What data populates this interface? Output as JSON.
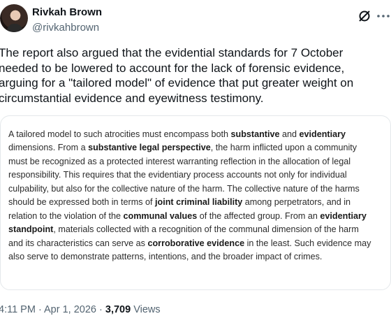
{
  "author": {
    "name": "Rivkah Brown",
    "handle": "@rivkahbrown"
  },
  "tweet": {
    "lines": [
      "The report also argued that the evidential standards for 7 October",
      "needed to be lowered to account for the lack of forensic evidence,",
      "arguing for a \"tailored model\" of evidence that put greater weight on",
      "circumstantial evidence and eyewitness testimony."
    ]
  },
  "image_text": {
    "l1a": "A tailored model to such atrocities must encompass both ",
    "l1b": "substantive",
    "l1c": " and ",
    "l1d": "evidentiary",
    "l2a": "dimensions. From a ",
    "l2b": "substantive legal perspective",
    "l2c": ", the harm inflicted upon a community",
    "l3": "must be recognized as a protected interest warranting reflection in the allocation of legal",
    "l4": "responsibility. This requires that the evidentiary process accounts not only for individual",
    "l5": "culpability, but also for the collective nature of the harm. The collective nature of the harms",
    "l6a": "should be expressed both in terms of ",
    "l6b": "joint criminal liability",
    "l6c": " among perpetrators, and in",
    "l7a": "relation to the violation of the ",
    "l7b": "communal values",
    "l7c": " of the affected group. From an ",
    "l7d": "evidentiary",
    "l8a": "standpoint",
    "l8b": ", materials collected with a recognition of the communal dimension of the harm",
    "l9a": "and its characteristics can serve as ",
    "l9b": "corroborative evidence",
    "l9c": " in the least. Such evidence may",
    "l10": "also serve to demonstrate patterns, intentions, and the broader impact of crimes."
  },
  "meta": {
    "time": "4:11 PM · Apr 1, 2026 · ",
    "views_count": "3,709",
    "views_label": " Views"
  },
  "icons": {
    "grok": "grok-icon",
    "more": "more-dots-icon"
  }
}
